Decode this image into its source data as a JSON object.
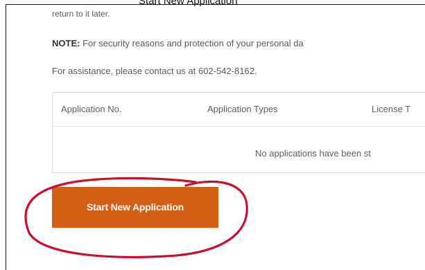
{
  "overlay": {
    "top_text": "Start New Application"
  },
  "content": {
    "line1": "return to it later.",
    "note_label": "NOTE:",
    "note_text": " For security reasons and protection of your personal da",
    "assistance": "For assistance, please contact us at 602-542-8162."
  },
  "table": {
    "headers": [
      "Application No.",
      "Application Types",
      "License T"
    ],
    "empty_message": "No applications have been st"
  },
  "actions": {
    "start_label": "Start New Application"
  },
  "colors": {
    "button": "#d35f16",
    "annotation": "#c8102e"
  }
}
